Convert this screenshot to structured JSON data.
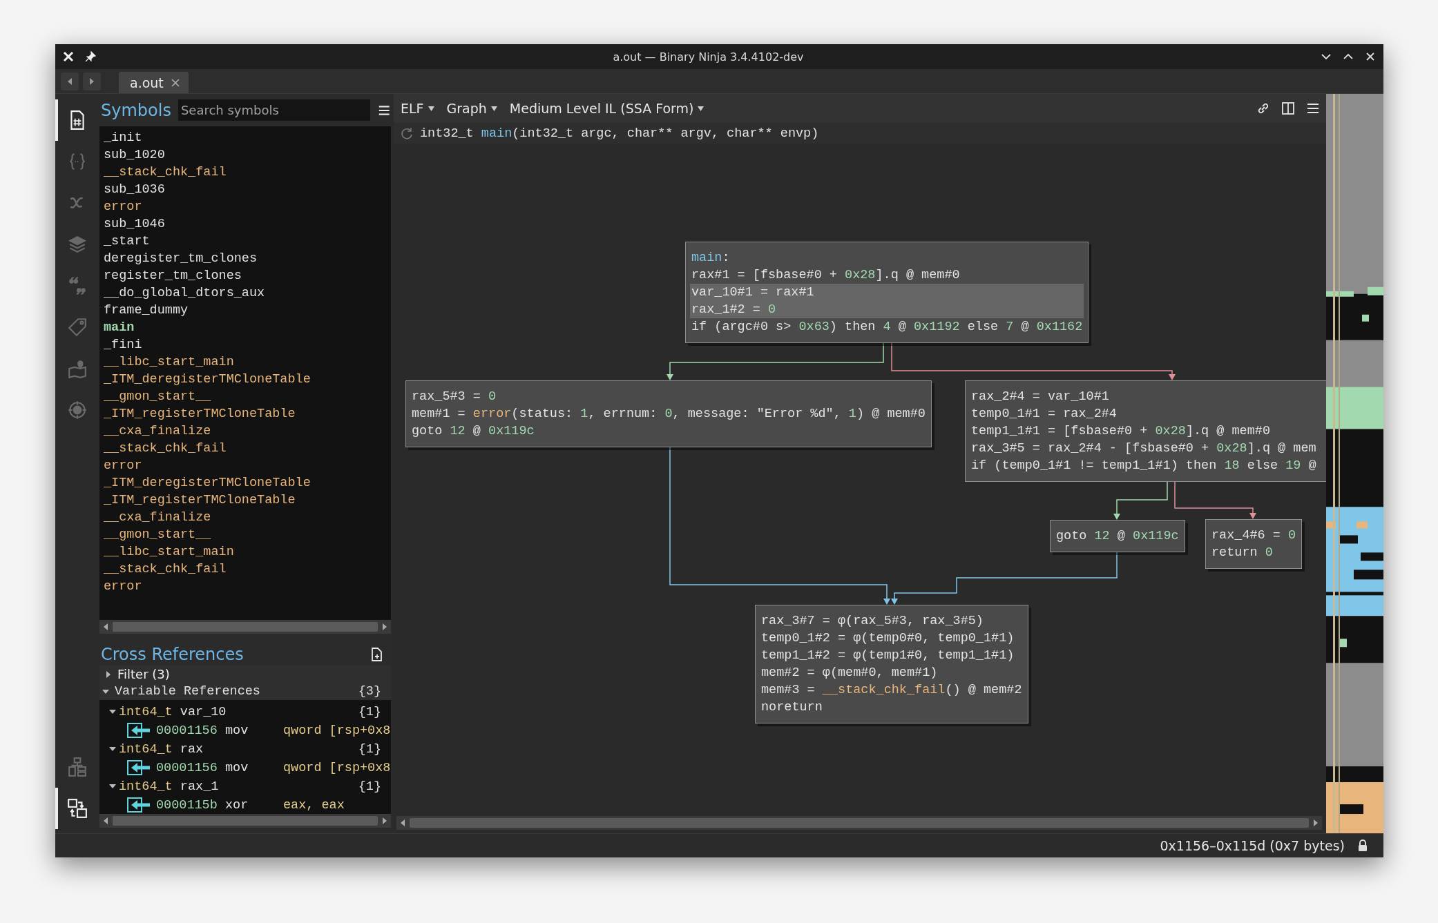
{
  "window": {
    "title": "a.out — Binary Ninja 3.4.4102-dev"
  },
  "tabs": [
    {
      "label": "a.out",
      "selected": true
    }
  ],
  "rail": {
    "top": [
      {
        "kind": "hash-document",
        "selected": true
      },
      {
        "kind": "braces",
        "selected": false
      },
      {
        "kind": "italic-x",
        "selected": false
      },
      {
        "kind": "layers",
        "selected": false
      },
      {
        "kind": "quote",
        "selected": false
      },
      {
        "kind": "tag",
        "selected": false
      },
      {
        "kind": "map-pin",
        "selected": false
      },
      {
        "kind": "compass",
        "selected": false
      }
    ],
    "bottom": [
      {
        "kind": "hierarchy",
        "selected": false
      },
      {
        "kind": "swap-boxes",
        "selected": true
      }
    ]
  },
  "symbols": {
    "title": "Symbols",
    "search": {
      "placeholder": "Search symbols"
    },
    "items": [
      {
        "name": "_init",
        "kind": "function",
        "selected": false
      },
      {
        "name": "sub_1020",
        "kind": "function",
        "selected": false
      },
      {
        "name": "__stack_chk_fail",
        "kind": "import",
        "selected": false
      },
      {
        "name": "sub_1036",
        "kind": "function",
        "selected": false
      },
      {
        "name": "error",
        "kind": "import",
        "selected": false
      },
      {
        "name": "sub_1046",
        "kind": "function",
        "selected": false
      },
      {
        "name": "_start",
        "kind": "function",
        "selected": false
      },
      {
        "name": "deregister_tm_clones",
        "kind": "function",
        "selected": false
      },
      {
        "name": "register_tm_clones",
        "kind": "function",
        "selected": false
      },
      {
        "name": "__do_global_dtors_aux",
        "kind": "function",
        "selected": false
      },
      {
        "name": "frame_dummy",
        "kind": "function",
        "selected": false
      },
      {
        "name": "main",
        "kind": "function",
        "selected": true
      },
      {
        "name": "_fini",
        "kind": "function",
        "selected": false
      },
      {
        "name": "__libc_start_main",
        "kind": "import",
        "selected": false
      },
      {
        "name": "_ITM_deregisterTMCloneTable",
        "kind": "import",
        "selected": false
      },
      {
        "name": "__gmon_start__",
        "kind": "import",
        "selected": false
      },
      {
        "name": "_ITM_registerTMCloneTable",
        "kind": "import",
        "selected": false
      },
      {
        "name": "__cxa_finalize",
        "kind": "import",
        "selected": false
      },
      {
        "name": "__stack_chk_fail",
        "kind": "import",
        "selected": false
      },
      {
        "name": "error",
        "kind": "import",
        "selected": false
      },
      {
        "name": "_ITM_deregisterTMCloneTable",
        "kind": "import",
        "selected": false
      },
      {
        "name": "_ITM_registerTMCloneTable",
        "kind": "import",
        "selected": false
      },
      {
        "name": "__cxa_finalize",
        "kind": "import",
        "selected": false
      },
      {
        "name": "__gmon_start__",
        "kind": "import",
        "selected": false
      },
      {
        "name": "__libc_start_main",
        "kind": "import",
        "selected": false
      },
      {
        "name": "__stack_chk_fail",
        "kind": "import",
        "selected": false
      },
      {
        "name": "error",
        "kind": "import",
        "selected": false
      }
    ]
  },
  "cross_references": {
    "title": "Cross References",
    "filter": {
      "label": "Filter (3)",
      "expanded": false
    },
    "group": {
      "label": "Variable References",
      "count": "{3}",
      "expanded": true
    },
    "variables": [
      {
        "type": "int64_t",
        "name": "var_10",
        "count": "{1}",
        "expanded": true,
        "refs": [
          {
            "address": "00001156",
            "mnemonic": "mov",
            "operands": "qword [rsp+0x8"
          }
        ]
      },
      {
        "type": "int64_t",
        "name": "rax",
        "count": "{1}",
        "expanded": true,
        "refs": [
          {
            "address": "00001156",
            "mnemonic": "mov",
            "operands": "qword [rsp+0x8"
          }
        ]
      },
      {
        "type": "int64_t",
        "name": "rax_1",
        "count": "{1}",
        "expanded": true,
        "refs": [
          {
            "address": "0000115b",
            "mnemonic": "xor",
            "operands": "eax, eax"
          }
        ]
      }
    ]
  },
  "view": {
    "menus": [
      {
        "label": "ELF"
      },
      {
        "label": "Graph"
      },
      {
        "label": "Medium Level IL (SSA Form)"
      }
    ],
    "signature": [
      {
        "text": "int32_t ",
        "kind": "plain"
      },
      {
        "text": "main",
        "kind": "func"
      },
      {
        "text": "(int32_t argc, char** argv, char** envp)",
        "kind": "plain"
      }
    ],
    "nodes": [
      {
        "lines": [
          {
            "selected": false,
            "tokens": [
              {
                "text": "main",
                "kind": "func"
              },
              {
                "text": ":",
                "kind": "plain"
              }
            ]
          },
          {
            "selected": false,
            "tokens": [
              {
                "text": "rax#1 = [fsbase#0 + ",
                "kind": "plain"
              },
              {
                "text": "0x28",
                "kind": "number"
              },
              {
                "text": "].q @ mem#0",
                "kind": "plain"
              }
            ]
          },
          {
            "selected": true,
            "tokens": [
              {
                "text": "var_10#1 = rax#1",
                "kind": "plain"
              }
            ]
          },
          {
            "selected": true,
            "tokens": [
              {
                "text": "rax_1#2 = ",
                "kind": "plain"
              },
              {
                "text": "0",
                "kind": "number"
              }
            ]
          },
          {
            "selected": false,
            "tokens": [
              {
                "text": "if (argc#0 s> ",
                "kind": "plain"
              },
              {
                "text": "0x63",
                "kind": "number"
              },
              {
                "text": ") then ",
                "kind": "plain"
              },
              {
                "text": "4",
                "kind": "number"
              },
              {
                "text": " @ ",
                "kind": "plain"
              },
              {
                "text": "0x1192",
                "kind": "number"
              },
              {
                "text": " else ",
                "kind": "plain"
              },
              {
                "text": "7",
                "kind": "number"
              },
              {
                "text": " @ ",
                "kind": "plain"
              },
              {
                "text": "0x1162",
                "kind": "number"
              }
            ]
          }
        ]
      },
      {
        "lines": [
          {
            "selected": false,
            "tokens": [
              {
                "text": "rax_5#3 = ",
                "kind": "plain"
              },
              {
                "text": "0",
                "kind": "number"
              }
            ]
          },
          {
            "selected": false,
            "tokens": [
              {
                "text": "mem#1 = ",
                "kind": "plain"
              },
              {
                "text": "error",
                "kind": "import"
              },
              {
                "text": "(status: ",
                "kind": "plain"
              },
              {
                "text": "1",
                "kind": "number"
              },
              {
                "text": ", errnum: ",
                "kind": "plain"
              },
              {
                "text": "0",
                "kind": "number"
              },
              {
                "text": ", message: \"Error %d\", ",
                "kind": "plain"
              },
              {
                "text": "1",
                "kind": "number"
              },
              {
                "text": ") @ mem#0",
                "kind": "plain"
              }
            ]
          },
          {
            "selected": false,
            "tokens": [
              {
                "text": "goto ",
                "kind": "plain"
              },
              {
                "text": "12",
                "kind": "number"
              },
              {
                "text": " @ ",
                "kind": "plain"
              },
              {
                "text": "0x119c",
                "kind": "number"
              }
            ]
          }
        ]
      },
      {
        "lines": [
          {
            "selected": false,
            "tokens": [
              {
                "text": "rax_2#4 = var_10#1",
                "kind": "plain"
              }
            ]
          },
          {
            "selected": false,
            "tokens": [
              {
                "text": "temp0_1#1 = rax_2#4",
                "kind": "plain"
              }
            ]
          },
          {
            "selected": false,
            "tokens": [
              {
                "text": "temp1_1#1 = [fsbase#0 + ",
                "kind": "plain"
              },
              {
                "text": "0x28",
                "kind": "number"
              },
              {
                "text": "].q @ mem#0",
                "kind": "plain"
              }
            ]
          },
          {
            "selected": false,
            "tokens": [
              {
                "text": "rax_3#5 = rax_2#4 - [fsbase#0 + ",
                "kind": "plain"
              },
              {
                "text": "0x28",
                "kind": "number"
              },
              {
                "text": "].q @ mem",
                "kind": "plain"
              }
            ]
          },
          {
            "selected": false,
            "tokens": [
              {
                "text": "if (temp0_1#1 != temp1_1#1) then ",
                "kind": "plain"
              },
              {
                "text": "18",
                "kind": "number"
              },
              {
                "text": " else ",
                "kind": "plain"
              },
              {
                "text": "19",
                "kind": "number"
              },
              {
                "text": " @",
                "kind": "plain"
              }
            ]
          }
        ]
      },
      {
        "lines": [
          {
            "selected": false,
            "tokens": [
              {
                "text": "goto ",
                "kind": "plain"
              },
              {
                "text": "12",
                "kind": "number"
              },
              {
                "text": " @ ",
                "kind": "plain"
              },
              {
                "text": "0x119c",
                "kind": "number"
              }
            ]
          }
        ]
      },
      {
        "lines": [
          {
            "selected": false,
            "tokens": [
              {
                "text": "rax_4#6 = ",
                "kind": "plain"
              },
              {
                "text": "0",
                "kind": "number"
              }
            ]
          },
          {
            "selected": false,
            "tokens": [
              {
                "text": "return ",
                "kind": "plain"
              },
              {
                "text": "0",
                "kind": "number"
              }
            ]
          }
        ]
      },
      {
        "lines": [
          {
            "selected": false,
            "tokens": [
              {
                "text": "rax_3#7 = φ(rax_5#3, rax_3#5)",
                "kind": "plain"
              }
            ]
          },
          {
            "selected": false,
            "tokens": [
              {
                "text": "temp0_1#2 = φ(temp0#0, temp0_1#1)",
                "kind": "plain"
              }
            ]
          },
          {
            "selected": false,
            "tokens": [
              {
                "text": "temp1_1#2 = φ(temp1#0, temp1_1#1)",
                "kind": "plain"
              }
            ]
          },
          {
            "selected": false,
            "tokens": [
              {
                "text": "mem#2 = φ(mem#0, mem#1)",
                "kind": "plain"
              }
            ]
          },
          {
            "selected": false,
            "tokens": [
              {
                "text": "mem#3 = ",
                "kind": "plain"
              },
              {
                "text": "__stack_chk_fail",
                "kind": "import"
              },
              {
                "text": "() @ mem#2",
                "kind": "plain"
              }
            ]
          },
          {
            "selected": false,
            "tokens": [
              {
                "text": "noreturn",
                "kind": "plain"
              }
            ]
          }
        ]
      }
    ],
    "edges": [
      {
        "kind": "true"
      },
      {
        "kind": "false"
      },
      {
        "kind": "unconditional"
      },
      {
        "kind": "true"
      },
      {
        "kind": "false"
      },
      {
        "kind": "unconditional"
      }
    ]
  },
  "status_bar": {
    "selection": "0x1156–0x115d (0x7 bytes)"
  }
}
